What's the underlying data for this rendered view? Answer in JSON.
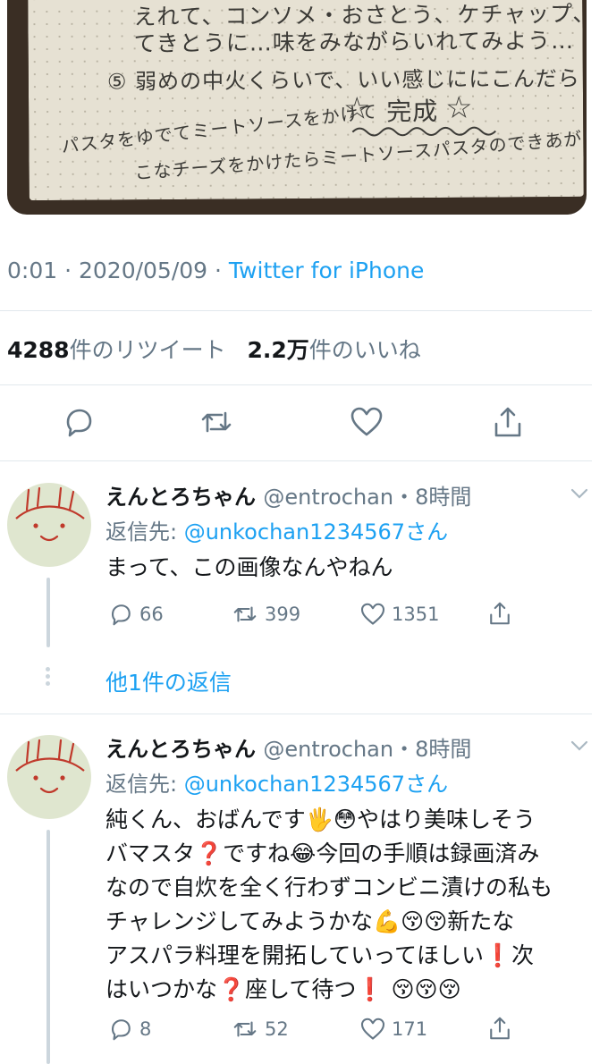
{
  "photo": {
    "line1": "えれて、コンソメ・おさとう、ケチャップ、ウスターソースを",
    "line2": "てきとうに…味をみながらいれてみよう…",
    "line3": "⑤ 弱めの中火くらいで、いい感じににこんだら",
    "line4": "完成",
    "line5": "パスタをゆでてミートソースをかけて",
    "line6": "こなチーズをかけたらミートソースパスタのできあがり"
  },
  "tweet_meta": {
    "time": "0:01",
    "sep": " · ",
    "date": "2020/05/09",
    "sep2": " · ",
    "source": "Twitter for iPhone"
  },
  "stats": {
    "retweets_count": "4288",
    "retweets_label": "件のリツイート",
    "likes_count": "2.2万",
    "likes_label": "件のいいね"
  },
  "action_icons": [
    "reply-icon",
    "retweet-icon",
    "like-icon",
    "share-icon"
  ],
  "replies": [
    {
      "display_name": "えんとろちゃん",
      "handle": "@entrochan",
      "time": "・8時間",
      "replying_label": "返信先: ",
      "replying_to": "@unkochan1234567さん",
      "text": "まって、この画像なんやねん",
      "reply_count": "66",
      "retweet_count": "399",
      "like_count": "1351"
    },
    {
      "display_name": "えんとろちゃん",
      "handle": "@entrochan",
      "time": "・8時間",
      "replying_label": "返信先: ",
      "replying_to": "@unkochan1234567さん",
      "text_lines": [
        "純くん、おばんです🖐😳やはり美味しそう",
        "バマスタ❓ですね😂今回の手順は録画済み",
        "なので自炊を全く行わずコンビニ漬けの私も",
        "チャレンジしてみようかな💪😚😚新たな",
        "アスパラ料理を開拓していってほしい❗次",
        "はいつかな❓座して待つ❗ 😚😚😚"
      ],
      "reply_count": "8",
      "retweet_count": "52",
      "like_count": "171"
    }
  ],
  "more_replies": "他1件の返信",
  "colors": {
    "link": "#1da1f2",
    "muted": "#657786",
    "divider": "#e1e8ed"
  }
}
